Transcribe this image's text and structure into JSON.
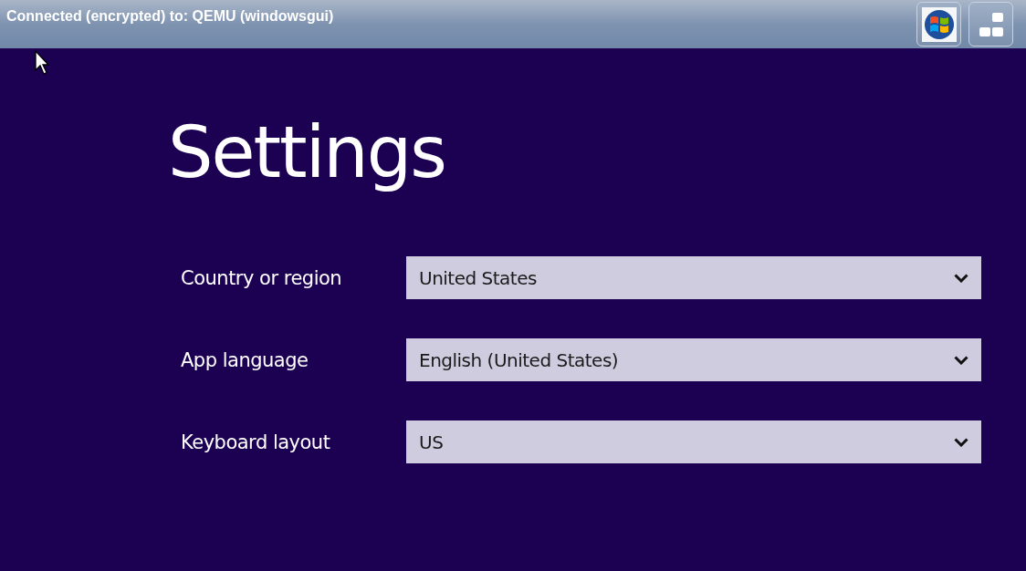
{
  "connection_bar": {
    "title": "Connected (encrypted) to: QEMU (windowsgui)"
  },
  "settings": {
    "heading": "Settings",
    "fields": [
      {
        "label": "Country or region",
        "value": "United States"
      },
      {
        "label": "App language",
        "value": "English (United States)"
      },
      {
        "label": "Keyboard layout",
        "value": "US"
      }
    ]
  }
}
